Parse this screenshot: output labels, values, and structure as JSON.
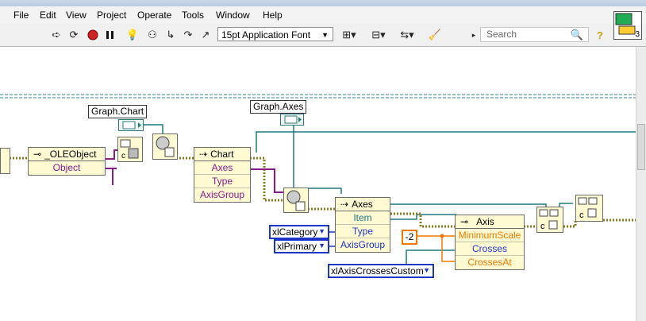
{
  "menu": {
    "items": [
      {
        "label": "File"
      },
      {
        "label": "Edit"
      },
      {
        "label": "View"
      },
      {
        "label": "Project"
      },
      {
        "label": "Operate"
      },
      {
        "label": "Tools"
      },
      {
        "label": "Window"
      },
      {
        "label": "Help"
      }
    ]
  },
  "toolbar": {
    "font": "15pt Application Font",
    "search_placeholder": "Search",
    "icons": [
      "run-arrow",
      "run-continuous",
      "abort",
      "pause",
      "highlight-bulb",
      "retain-wire",
      "step-into",
      "step-over",
      "step-out",
      "align",
      "distribute",
      "reorder",
      "cleanup",
      "search",
      "help"
    ]
  },
  "vi_icon": {
    "label": "3"
  },
  "diagram": {
    "graph_chart_label": "Graph.Chart",
    "graph_axes_label": "Graph.Axes",
    "ole_node": {
      "title": "_OLEObject",
      "row": "Object"
    },
    "chart_node": {
      "title": "Chart",
      "rows": [
        "Axes",
        "Type",
        "AxisGroup"
      ]
    },
    "axes_node": {
      "title": "Axes",
      "rows": [
        "Item",
        "Type",
        "AxisGroup"
      ]
    },
    "axis_node": {
      "title": "Axis",
      "rows": [
        "MinimumScale",
        "Crosses",
        "CrossesAt"
      ]
    },
    "xlcategory": "xlCategory",
    "xlprimary": "xlPrimary",
    "xlaxiscrosses": "xlAxisCrossesCustom",
    "neg2": "-2",
    "colors": {
      "purple": "#8a1a8a",
      "olive": "#8a7a1a",
      "teal": "#1f7a80",
      "blue": "#1b35c8",
      "orange": "#f07800"
    }
  }
}
